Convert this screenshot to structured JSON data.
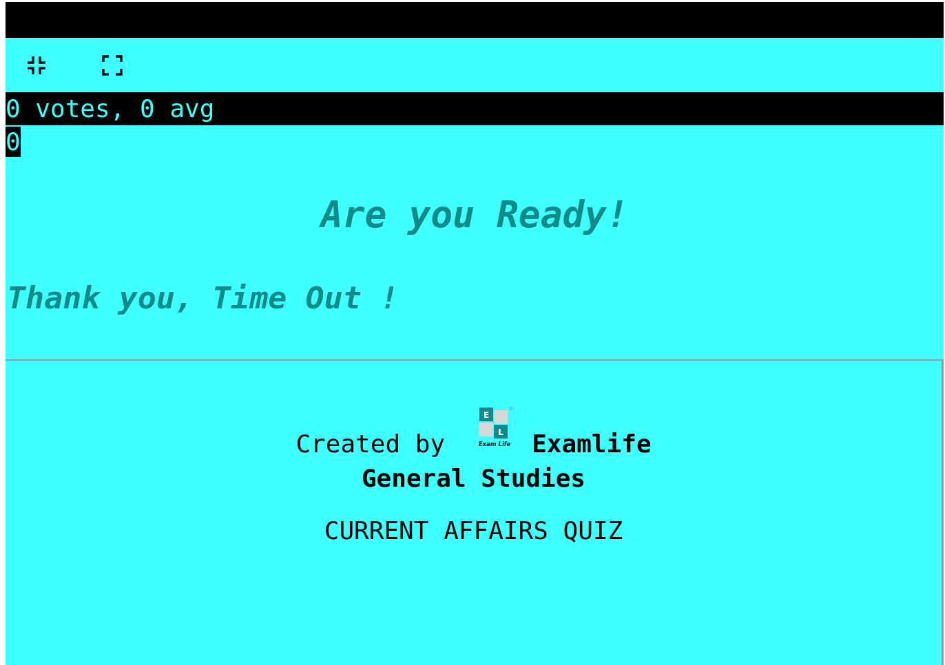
{
  "toolbar": {
    "buttons": [
      {
        "kind": "exit-fullscreen"
      },
      {
        "kind": "fullscreen"
      }
    ]
  },
  "rating": {
    "summary": "0 votes, 0 avg",
    "count": "0"
  },
  "quiz": {
    "title": "Are you Ready!",
    "message": "Thank you, Time Out !"
  },
  "footer": {
    "created_by": "Created by",
    "logo": {
      "letters": [
        "E",
        "L"
      ],
      "name": "Exam Life"
    },
    "brand": "Examlife",
    "category": "General Studies",
    "quiz_name": "CURRENT AFFAIRS QUIZ"
  }
}
